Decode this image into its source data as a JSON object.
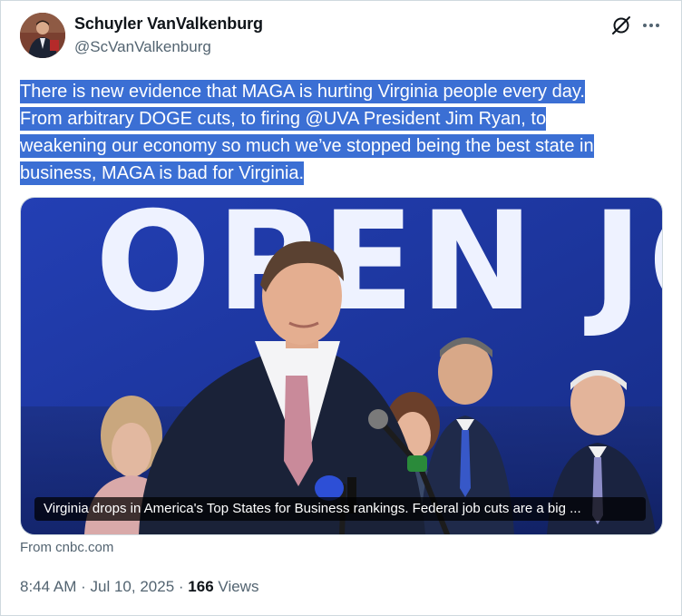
{
  "author": {
    "name": "Schuyler VanValkenburg",
    "handle": "@ScVanValkenburg"
  },
  "icons": {
    "grok": "grok-slash-icon",
    "more": "more-dots-icon"
  },
  "tweet": {
    "lines": [
      "There is new evidence that MAGA is hurting Virginia people every day.",
      "From arbitrary DOGE cuts, to firing @UVA President Jim Ryan, to",
      "weakening our economy so much we’ve stopped being the best state in",
      "business, MAGA is bad for Virginia."
    ]
  },
  "card": {
    "sign_text": "OPEN JOBS",
    "caption": "Virginia drops in America's Top States for Business rankings. Federal job cuts are a big ...",
    "source": "From cnbc.com"
  },
  "meta": {
    "time": "8:44 AM",
    "date": "Jul 10, 2025",
    "views_count": "166",
    "views_label": "Views",
    "separator": "·"
  },
  "colors": {
    "selection_highlight": "#3b6fd4",
    "secondary_text": "#536471",
    "backdrop_blue": "#1e3aa8"
  }
}
